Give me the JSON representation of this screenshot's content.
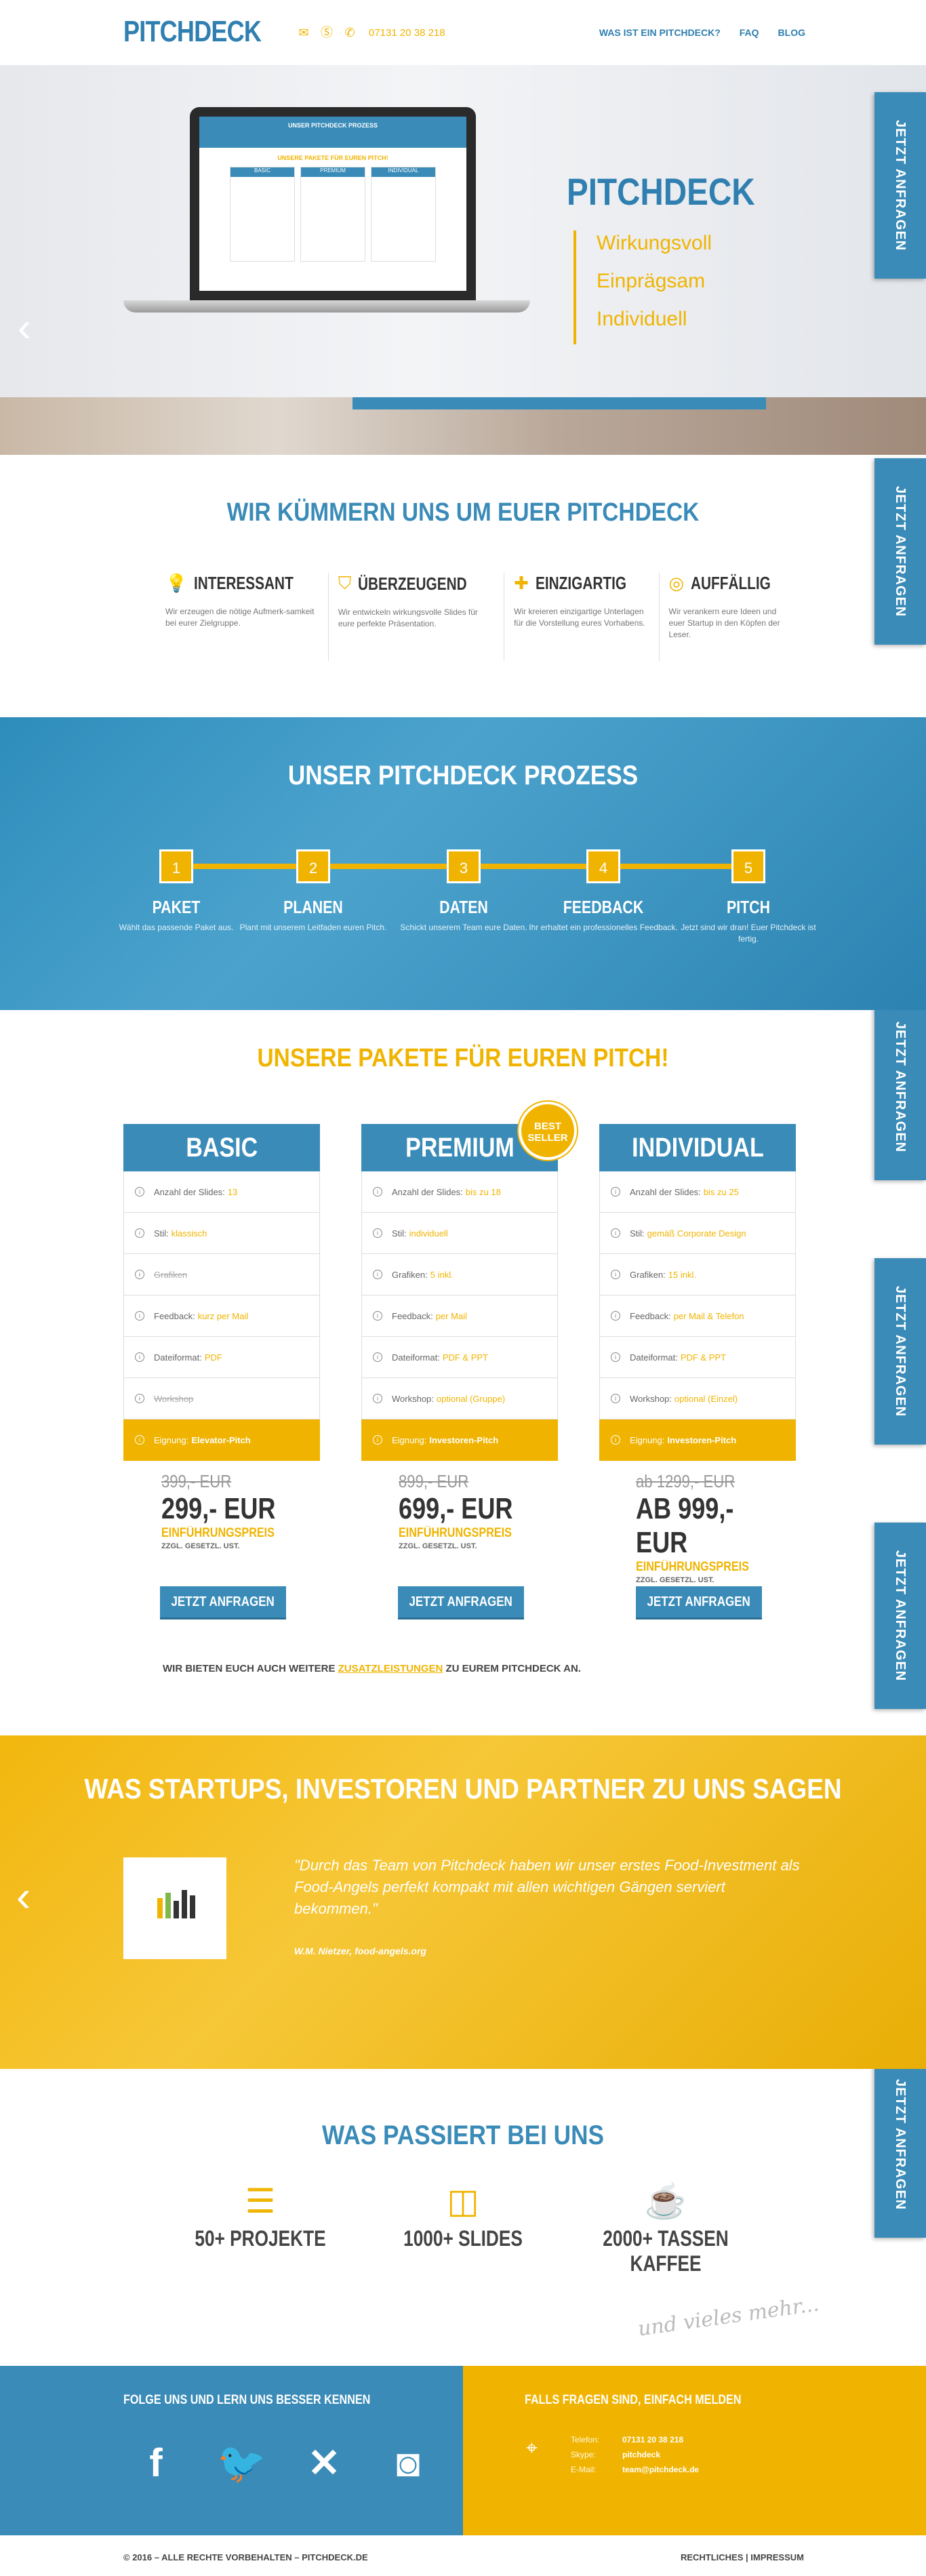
{
  "header": {
    "logo": "PITCHDECK",
    "phone": "07131 20 38 218",
    "nav": [
      "WAS IST EIN PITCHDECK?",
      "FAQ",
      "BLOG"
    ]
  },
  "side_cta_label": "JETZT ANFRAGEN",
  "hero": {
    "title": "PITCHDECK",
    "items": [
      "Wirkungsvoll",
      "Einprägsam",
      "Individuell"
    ],
    "screen_head": "UNSER PITCHDECK PROZESS",
    "screen_sub": "UNSERE PAKETE FÜR EUREN PITCH!",
    "screen_cols": [
      "BASIC",
      "PREMIUM",
      "INDIVIDUAL"
    ]
  },
  "intro": {
    "title": "WIR KÜMMERN UNS UM EUER PITCHDECK",
    "features": [
      {
        "title": "INTERESSANT",
        "text": "Wir erzeugen die nötige Aufmerk-samkeit bei eurer Zielgruppe.",
        "icon": "lightbulb-icon"
      },
      {
        "title": "ÜBERZEUGEND",
        "text": "Wir entwickeln wirkungsvolle Slides für eure perfekte Präsentation.",
        "icon": "shield-check-icon"
      },
      {
        "title": "EINZIGARTIG",
        "text": "Wir kreieren einzigartige Unterlagen für die Vorstellung eures Vorhabens.",
        "icon": "puzzle-icon"
      },
      {
        "title": "AUFFÄLLIG",
        "text": "Wir verankern eure Ideen und euer Startup in den Köpfen der Leser.",
        "icon": "target-icon"
      }
    ]
  },
  "process": {
    "title": "UNSER PITCHDECK PROZESS",
    "steps": [
      {
        "num": "1",
        "title": "PAKET",
        "text": "Wählt das passende Paket aus."
      },
      {
        "num": "2",
        "title": "PLANEN",
        "text": "Plant mit unserem Leitfaden euren Pitch."
      },
      {
        "num": "3",
        "title": "DATEN",
        "text": "Schickt unserem Team eure Daten."
      },
      {
        "num": "4",
        "title": "FEEDBACK",
        "text": "Ihr erhaltet ein professionelles Feedback."
      },
      {
        "num": "5",
        "title": "PITCH",
        "text": "Jetzt sind wir dran! Euer Pitchdeck ist fertig."
      }
    ]
  },
  "pricing": {
    "title": "UNSERE PAKETE FÜR EUREN PITCH!",
    "badge": "BEST SELLER",
    "plans": [
      {
        "name": "BASIC",
        "rows": [
          {
            "label": "Anzahl der Slides:",
            "value": "13",
            "strike": false
          },
          {
            "label": "Stil:",
            "value": "klassisch",
            "strike": false
          },
          {
            "label": "Grafiken",
            "value": "",
            "strike": true
          },
          {
            "label": "Feedback:",
            "value": "kurz per Mail",
            "strike": false
          },
          {
            "label": "Dateiformat:",
            "value": "PDF",
            "strike": false
          },
          {
            "label": "Workshop",
            "value": "",
            "strike": true
          }
        ],
        "foot_label": "Eignung:",
        "foot_value": "Elevator-Pitch",
        "old_price": "399,- EUR",
        "price": "299,- EUR",
        "intro": "EINFÜHRUNGSPREIS",
        "tax": "ZZGL. GESETZL. UST.",
        "button": "JETZT ANFRAGEN"
      },
      {
        "name": "PREMIUM",
        "rows": [
          {
            "label": "Anzahl der Slides:",
            "value": "bis zu 18",
            "strike": false
          },
          {
            "label": "Stil:",
            "value": "individuell",
            "strike": false
          },
          {
            "label": "Grafiken:",
            "value": "5 inkl.",
            "strike": false
          },
          {
            "label": "Feedback:",
            "value": "per Mail",
            "strike": false
          },
          {
            "label": "Dateiformat:",
            "value": "PDF & PPT",
            "strike": false
          },
          {
            "label": "Workshop:",
            "value": "optional (Gruppe)",
            "strike": false
          }
        ],
        "foot_label": "Eignung:",
        "foot_value": "Investoren-Pitch",
        "old_price": "899,- EUR",
        "price": "699,- EUR",
        "intro": "EINFÜHRUNGSPREIS",
        "tax": "ZZGL. GESETZL. UST.",
        "button": "JETZT ANFRAGEN"
      },
      {
        "name": "INDIVIDUAL",
        "rows": [
          {
            "label": "Anzahl der Slides:",
            "value": "bis zu 25",
            "strike": false
          },
          {
            "label": "Stil:",
            "value": "gemäß Corporate Design",
            "strike": false
          },
          {
            "label": "Grafiken:",
            "value": "15 inkl.",
            "strike": false
          },
          {
            "label": "Feedback:",
            "value": "per Mail & Telefon",
            "strike": false
          },
          {
            "label": "Dateiformat:",
            "value": "PDF & PPT",
            "strike": false
          },
          {
            "label": "Workshop:",
            "value": "optional (Einzel)",
            "strike": false
          }
        ],
        "foot_label": "Eignung:",
        "foot_value": "Investoren-Pitch",
        "old_price": "ab 1299,- EUR",
        "price": "AB 999,- EUR",
        "intro": "EINFÜHRUNGSPREIS",
        "tax": "ZZGL. GESETZL. UST.",
        "button": "JETZT ANFRAGEN"
      }
    ],
    "extra_before": "WIR BIETEN EUCH AUCH WEITERE",
    "extra_link": "ZUSATZLEISTUNGEN",
    "extra_after": "ZU EUREM PITCHDECK AN."
  },
  "testimonials": {
    "title": "WAS STARTUPS, INVESTOREN UND PARTNER ZU UNS SAGEN",
    "quote": "\"Durch das Team von Pitchdeck haben wir unser erstes Food-Investment als Food-Angels perfekt kompakt mit allen wichtigen Gängen serviert bekommen.\"",
    "author": "W.M. Nietzer, food-angels.org"
  },
  "stats": {
    "title": "WAS PASSIERT BEI UNS",
    "items": [
      {
        "label": "50+ PROJEKTE",
        "icon": "checklist-icon"
      },
      {
        "label": "1000+ SLIDES",
        "icon": "book-icon"
      },
      {
        "label": "2000+ TASSEN KAFFEE",
        "icon": "coffee-cup-icon"
      }
    ],
    "more": "und vieles mehr..."
  },
  "footer": {
    "social_title": "FOLGE UNS UND LERN UNS BESSER KENNEN",
    "contact_title": "FALLS FRAGEN SIND, EINFACH MELDEN",
    "contact": [
      {
        "key": "Telefon:",
        "value": "07131 20 38 218"
      },
      {
        "key": "Skype:",
        "value": "pitchdeck"
      },
      {
        "key": "E-Mail:",
        "value": "team@pitchdeck.de"
      }
    ],
    "copyright": "© 2016 – ALLE RECHTE VORBEHALTEN – PITCHDECK.DE",
    "legal": "RECHTLICHES | IMPRESSUM"
  },
  "colors": {
    "blue": "#3a8bb8",
    "yellow": "#f0b400"
  }
}
